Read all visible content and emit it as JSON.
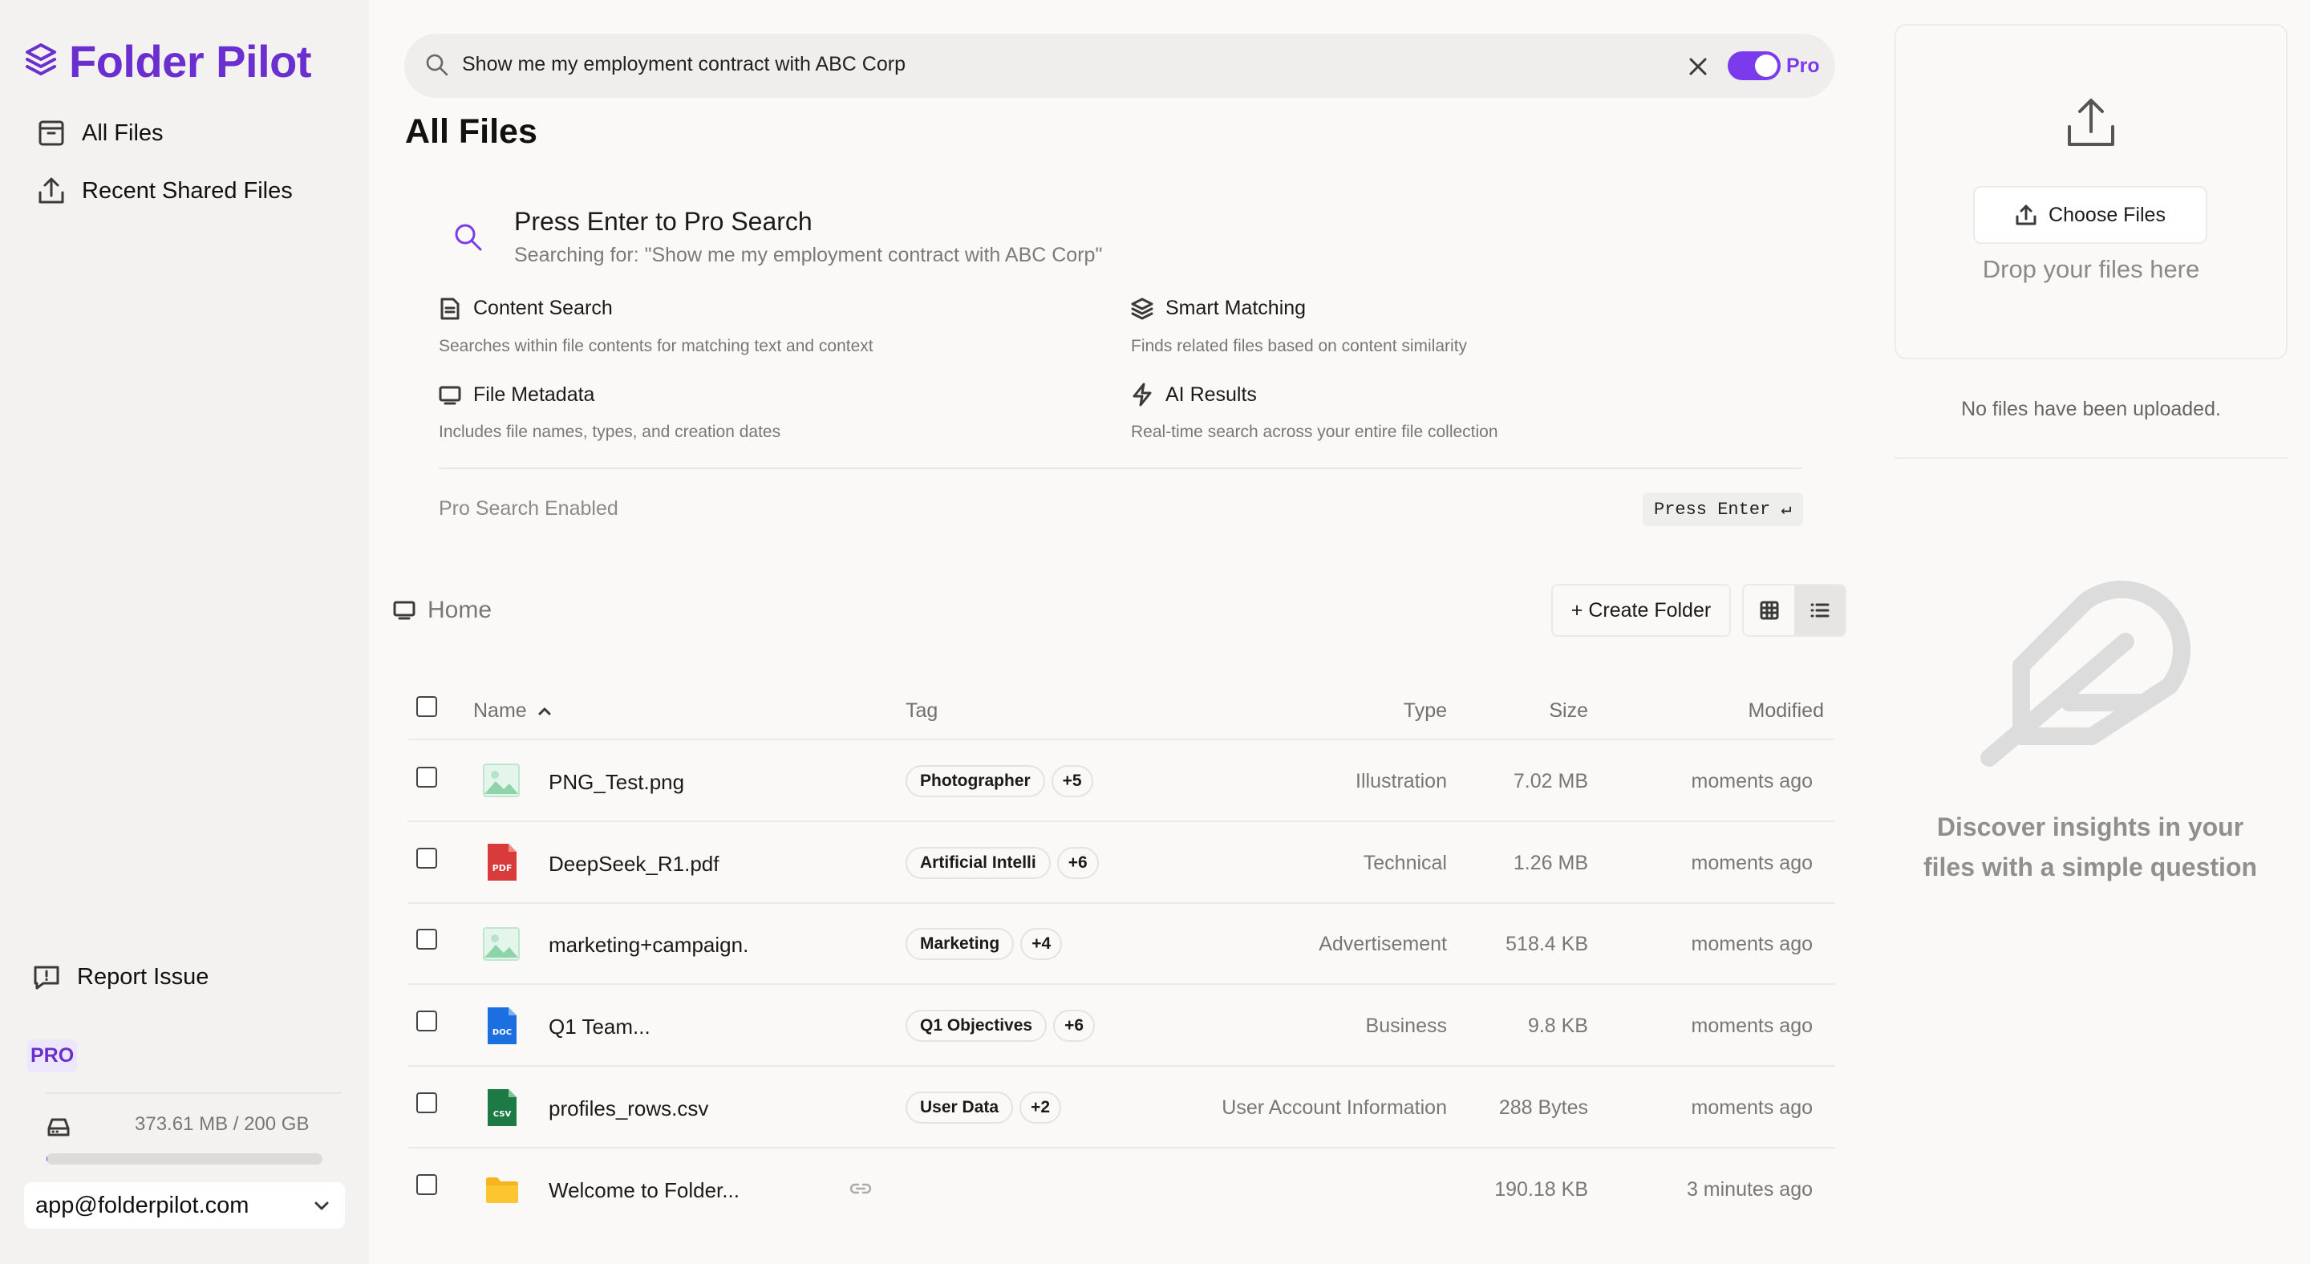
{
  "app": {
    "name": "Folder Pilot",
    "brand_color": "#6b2fd0"
  },
  "sidebar": {
    "items": [
      {
        "label": "All Files",
        "icon": "archive-icon"
      },
      {
        "label": "Recent Shared Files",
        "icon": "share-upload-icon"
      }
    ],
    "report_issue": "Report Issue",
    "plan_badge": "PRO",
    "storage": {
      "text": "373.61 MB / 200 GB",
      "used_fraction": 0.0018
    },
    "account": {
      "email": "app@folderpilot.com"
    }
  },
  "search": {
    "value": "Show me my employment contract with ABC Corp",
    "pro_toggle_on": true,
    "pro_label": "Pro"
  },
  "main": {
    "title": "All Files"
  },
  "pro_search": {
    "title": "Press Enter to Pro Search",
    "subtitle": "Searching for: \"Show me my employment contract with ABC Corp\"",
    "features": [
      {
        "title": "Content Search",
        "desc": "Searches within file contents for matching text and context",
        "icon": "document-icon"
      },
      {
        "title": "Smart Matching",
        "desc": "Finds related files based on content similarity",
        "icon": "layers-icon"
      },
      {
        "title": "File Metadata",
        "desc": "Includes file names, types, and creation dates",
        "icon": "monitor-icon"
      },
      {
        "title": "AI Results",
        "desc": "Real-time search across your entire file collection",
        "icon": "lightning-icon"
      }
    ],
    "status": "Pro Search Enabled",
    "enter_hint": "Press Enter ↵"
  },
  "browser": {
    "breadcrumb": "Home",
    "create_folder": "+ Create Folder",
    "view_mode": "list"
  },
  "table": {
    "columns": {
      "name": "Name",
      "tag": "Tag",
      "type": "Type",
      "size": "Size",
      "modified": "Modified"
    },
    "rows": [
      {
        "name": "PNG_Test.png",
        "icon": "image-file-icon",
        "tag": "Photographer",
        "tag_more": "+5",
        "type": "Illustration",
        "size": "7.02 MB",
        "modified": "moments ago"
      },
      {
        "name": "DeepSeek_R1.pdf",
        "icon": "pdf-file-icon",
        "tag": "Artificial Intelli",
        "tag_more": "+6",
        "type": "Technical",
        "size": "1.26 MB",
        "modified": "moments ago"
      },
      {
        "name": "marketing+campaign.",
        "icon": "image-file-icon",
        "tag": "Marketing",
        "tag_more": "+4",
        "type": "Advertisement",
        "size": "518.4 KB",
        "modified": "moments ago"
      },
      {
        "name": "Q1 Team...",
        "icon": "doc-file-icon",
        "tag": "Q1 Objectives",
        "tag_more": "+6",
        "type": "Business",
        "size": "9.8 KB",
        "modified": "moments ago"
      },
      {
        "name": "profiles_rows.csv",
        "icon": "csv-file-icon",
        "tag": "User Data",
        "tag_more": "+2",
        "type": "User Account Information",
        "size": "288 Bytes",
        "modified": "moments ago"
      },
      {
        "name": "Welcome to Folder...",
        "icon": "folder-icon",
        "tag": "",
        "tag_more": "",
        "type": "",
        "size": "190.18 KB",
        "modified": "3 minutes ago"
      }
    ]
  },
  "upload": {
    "choose_files": "Choose Files",
    "drop_text": "Drop your files here",
    "empty_text": "No files have been uploaded."
  },
  "insights": {
    "text": "Discover insights in your files with a simple question"
  }
}
